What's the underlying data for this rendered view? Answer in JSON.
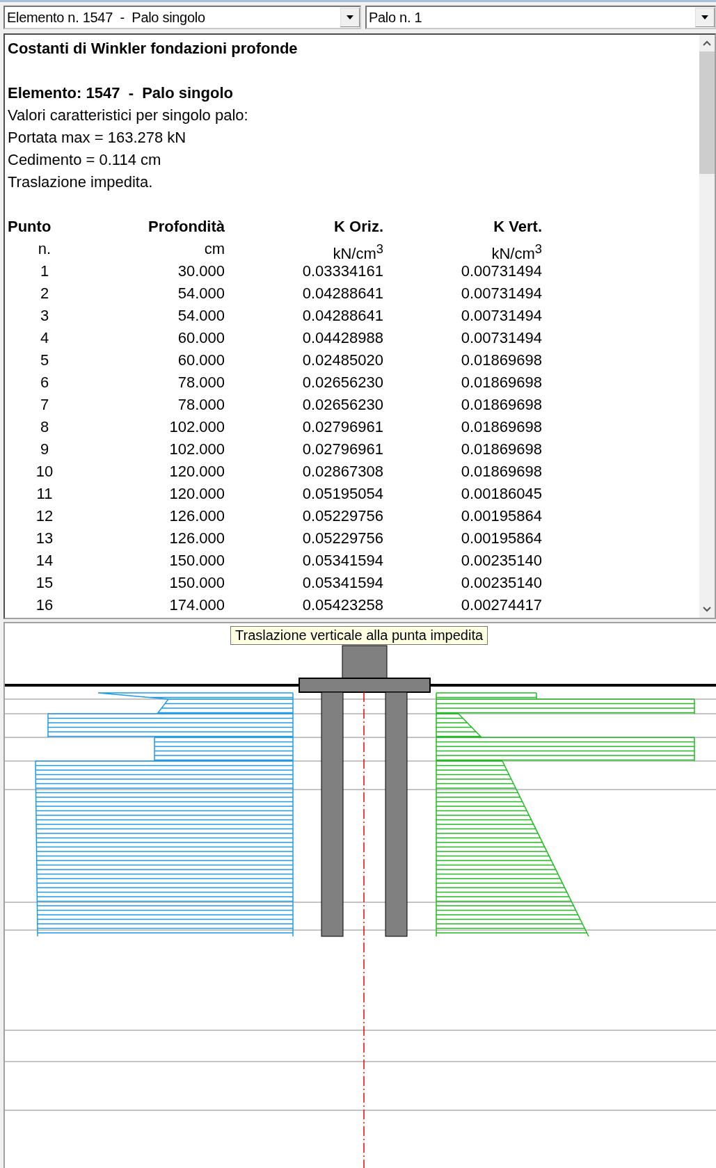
{
  "selectors": [
    {
      "value": "Elemento n. 1547  -  Palo singolo"
    },
    {
      "value": "Palo n. 1"
    }
  ],
  "report": {
    "title": "Costanti di Winkler fondazioni profonde",
    "element_heading": "Elemento: 1547  -  Palo singolo",
    "lines": [
      "Valori caratteristici per singolo palo:",
      "Portata max = 163.278 kN",
      "Cedimento = 0.114 cm",
      "Traslazione impedita."
    ],
    "table": {
      "columns": [
        {
          "header": "Punto",
          "unit": "n."
        },
        {
          "header": "Profondità",
          "unit": "cm"
        },
        {
          "header": "K Oriz.",
          "unit": "kN/cm$^{3}$"
        },
        {
          "header": "K Vert.",
          "unit": "kN/cm$^{3}$"
        }
      ],
      "rows": [
        [
          "1",
          "30.000",
          "0.03334161",
          "0.00731494"
        ],
        [
          "2",
          "54.000",
          "0.04288641",
          "0.00731494"
        ],
        [
          "3",
          "54.000",
          "0.04288641",
          "0.00731494"
        ],
        [
          "4",
          "60.000",
          "0.04428988",
          "0.00731494"
        ],
        [
          "5",
          "60.000",
          "0.02485020",
          "0.01869698"
        ],
        [
          "6",
          "78.000",
          "0.02656230",
          "0.01869698"
        ],
        [
          "7",
          "78.000",
          "0.02656230",
          "0.01869698"
        ],
        [
          "8",
          "102.000",
          "0.02796961",
          "0.01869698"
        ],
        [
          "9",
          "102.000",
          "0.02796961",
          "0.01869698"
        ],
        [
          "10",
          "120.000",
          "0.02867308",
          "0.01869698"
        ],
        [
          "11",
          "120.000",
          "0.05195054",
          "0.00186045"
        ],
        [
          "12",
          "126.000",
          "0.05229756",
          "0.00195864"
        ],
        [
          "13",
          "126.000",
          "0.05229756",
          "0.00195864"
        ],
        [
          "14",
          "150.000",
          "0.05341594",
          "0.00235140"
        ],
        [
          "15",
          "150.000",
          "0.05341594",
          "0.00235140"
        ],
        [
          "16",
          "174.000",
          "0.05423258",
          "0.00274417"
        ]
      ]
    }
  },
  "diagram": {
    "tooltip": "Traslazione verticale alla punta impedita"
  }
}
